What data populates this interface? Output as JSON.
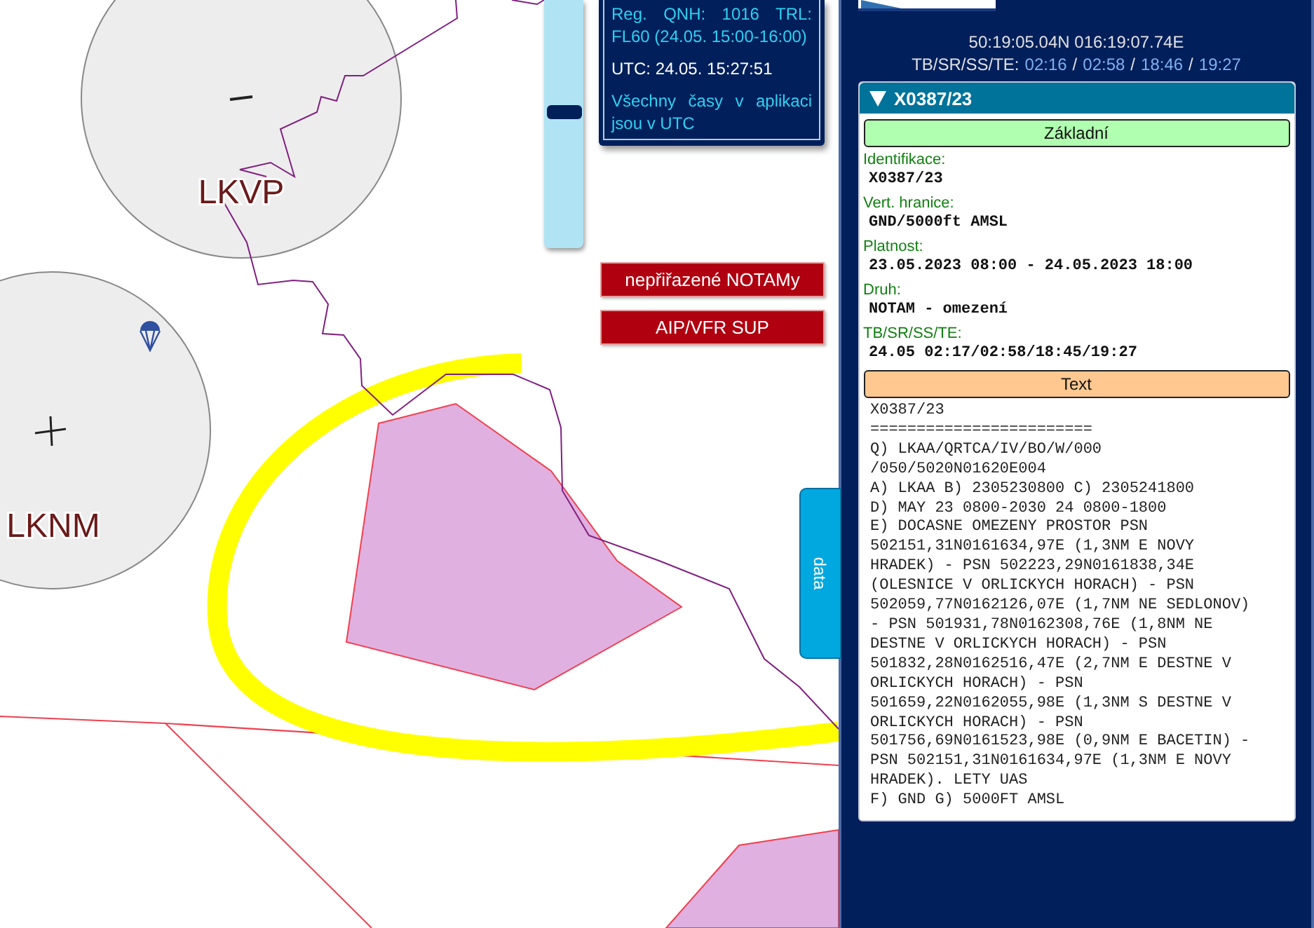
{
  "map": {
    "airports": [
      {
        "code": "LKVP",
        "kind": "minus"
      },
      {
        "code": "LKNM",
        "kind": "plus"
      }
    ],
    "zoom_slider": {
      "level": 0.56
    },
    "info": {
      "qnh": "Reg. QNH: 1016 TRL: FL60 (24.05. 15:00-16:00)",
      "utc": "UTC: 24.05. 15:27:51",
      "note": "Všechny časy v aplikaci jsou v UTC"
    },
    "buttons": [
      "nepřiřazené NOTAMy",
      "AIP/VFR SUP"
    ],
    "side_tab": "data"
  },
  "panel": {
    "coordinates": "50:19:05.04N 016:19:07.74E",
    "sun_label": "TB/SR/SS/TE:",
    "sun_times": [
      "02:16",
      "02:58",
      "18:46",
      "19:27"
    ],
    "separator": "/",
    "notam": {
      "id": "X0387/23",
      "expanded": true,
      "sections": [
        {
          "kind": "fields",
          "title": "Základní",
          "fields": [
            {
              "label": "Identifikace:",
              "value": "X0387/23"
            },
            {
              "label": "Vert. hranice:",
              "value": "GND/5000ft AMSL"
            },
            {
              "label": "Platnost:",
              "value": "23.05.2023 08:00 - 24.05.2023 18:00"
            },
            {
              "label": "Druh:",
              "value": "NOTAM - omezení"
            },
            {
              "label": "TB/SR/SS/TE:",
              "value": "24.05 02:17/02:58/18:45/19:27"
            }
          ]
        },
        {
          "kind": "text",
          "title": "Text",
          "lines": [
            "X0387/23",
            "========================",
            "Q) LKAA/QRTCA/IV/BO/W/000",
            "/050/5020N01620E004",
            "A) LKAA B) 2305230800 C) 2305241800",
            "D) MAY 23 0800-2030 24 0800-1800",
            "E) DOCASNE OMEZENY PROSTOR PSN",
            "502151,31N0161634,97E (1,3NM E NOVY",
            "HRADEK) - PSN 502223,29N0161838,34E",
            "(OLESNICE V ORLICKYCH HORACH) - PSN",
            "502059,77N0162126,07E (1,7NM NE SEDLONOV)",
            "- PSN 501931,78N0162308,76E (1,8NM NE",
            "DESTNE V ORLICKYCH HORACH) - PSN",
            "501832,28N0162516,47E (2,7NM E DESTNE V",
            "ORLICKYCH HORACH) - PSN",
            "501659,22N0162055,98E (1,3NM S DESTNE V",
            "ORLICKYCH HORACH) - PSN",
            "501756,69N0161523,98E (0,9NM E BACETIN) -",
            "PSN 502151,31N0161634,97E (1,3NM E NOVY",
            "HRADEK). LETY UAS",
            "F) GND G) 5000FT AMSL"
          ]
        }
      ]
    }
  }
}
